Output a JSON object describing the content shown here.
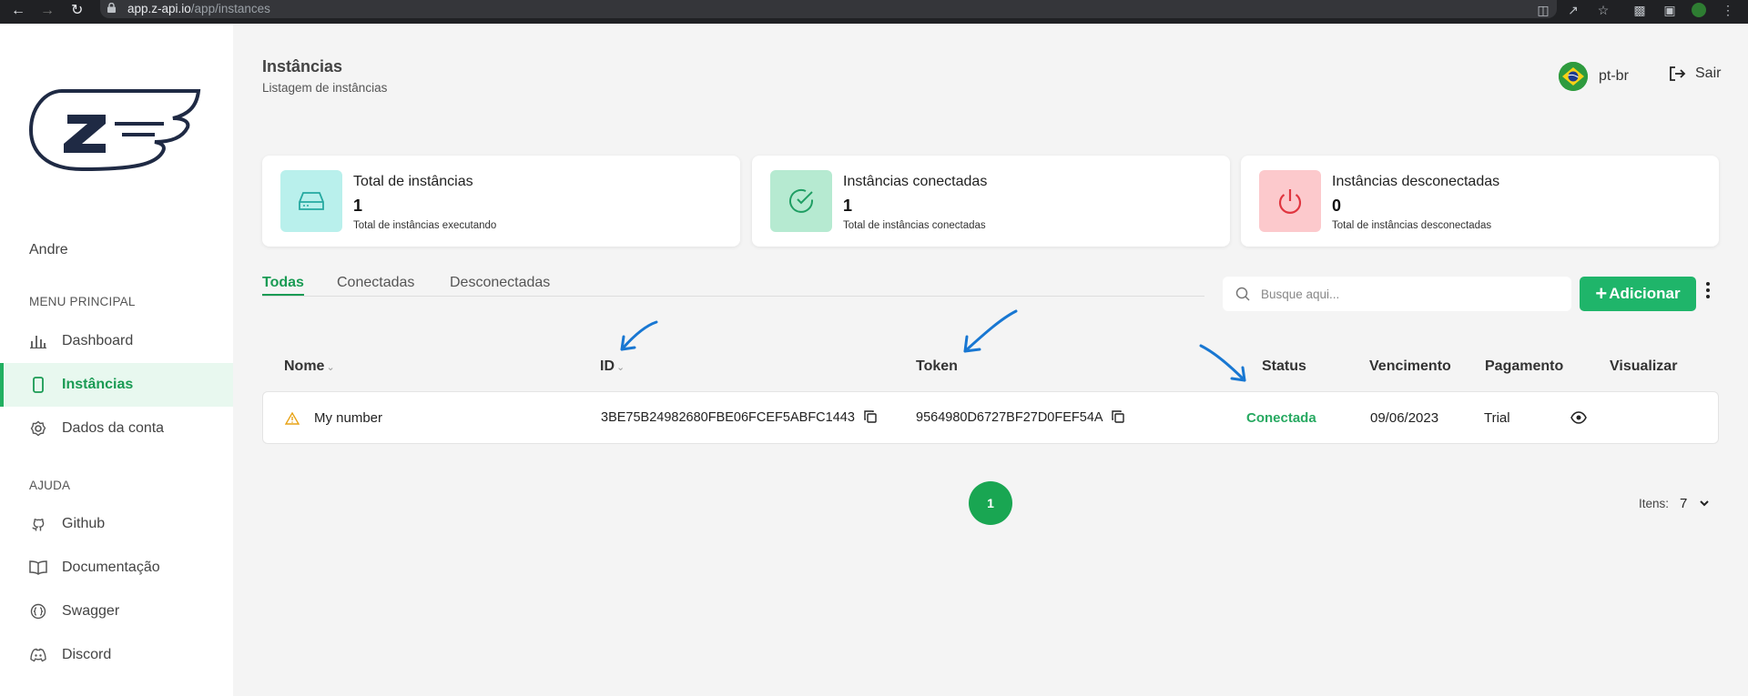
{
  "browser": {
    "url_host": "app.z-api.io",
    "url_path": "/app/instances"
  },
  "sidebar": {
    "user": "Andre",
    "main_menu_title": "MENU PRINCIPAL",
    "main_items": [
      {
        "label": "Dashboard",
        "icon": "bar-chart-icon"
      },
      {
        "label": "Instâncias",
        "icon": "phone-icon"
      },
      {
        "label": "Dados da conta",
        "icon": "gear-icon"
      }
    ],
    "help_title": "AJUDA",
    "help_items": [
      {
        "label": "Github",
        "icon": "github-icon"
      },
      {
        "label": "Documentação",
        "icon": "book-icon"
      },
      {
        "label": "Swagger",
        "icon": "swagger-icon"
      },
      {
        "label": "Discord",
        "icon": "discord-icon"
      }
    ]
  },
  "header": {
    "title": "Instâncias",
    "subtitle": "Listagem de instâncias",
    "language": "pt-br",
    "logout": "Sair"
  },
  "cards": [
    {
      "title": "Total de instâncias",
      "value": "1",
      "desc": "Total de instâncias executando",
      "color": "#b9f0ec",
      "icon": "hard-drive-icon"
    },
    {
      "title": "Instâncias conectadas",
      "value": "1",
      "desc": "Total de instâncias conectadas",
      "color": "#b6ead1",
      "icon": "check-circle-icon"
    },
    {
      "title": "Instâncias desconectadas",
      "value": "0",
      "desc": "Total de instâncias desconectadas",
      "color": "#fcc9cc",
      "icon": "power-icon"
    }
  ],
  "tabs": [
    "Todas",
    "Conectadas",
    "Desconectadas"
  ],
  "search": {
    "placeholder": "Busque aqui..."
  },
  "add_button": "Adicionar",
  "table": {
    "headers": {
      "name": "Nome",
      "id": "ID",
      "token": "Token",
      "status": "Status",
      "due": "Vencimento",
      "payment": "Pagamento",
      "view": "Visualizar"
    },
    "rows": [
      {
        "name": "My number",
        "id": "3BE75B24982680FBE06FCEF5ABFC1443",
        "token": "9564980D6727BF27D0FEF54A",
        "status": "Conectada",
        "due": "09/06/2023",
        "payment": "Trial"
      }
    ]
  },
  "pagination": {
    "current_page": "1",
    "items_label": "Itens:",
    "items_value": "7"
  },
  "colors": {
    "accent": "#1fb56a",
    "arrow": "#1877d2"
  }
}
